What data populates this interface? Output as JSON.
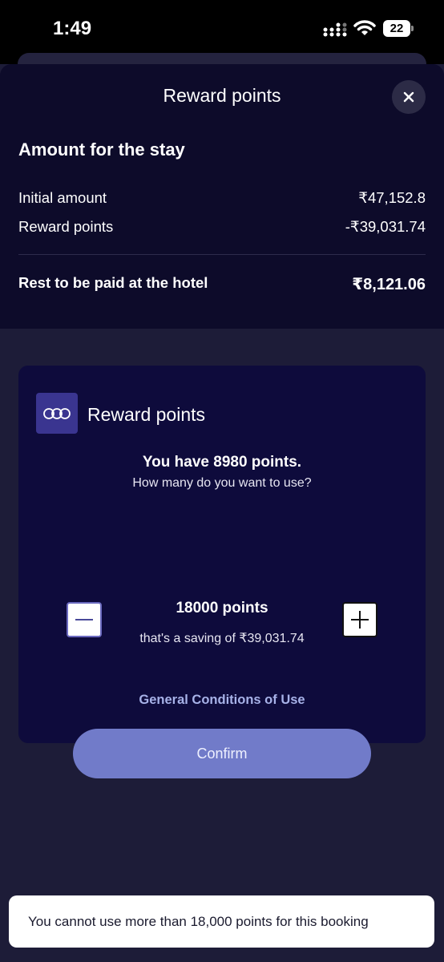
{
  "status_bar": {
    "time": "1:49",
    "battery": "22",
    "icons": [
      "signal-icon",
      "wifi-icon",
      "battery-icon"
    ]
  },
  "sheet": {
    "title": "Reward points",
    "close_icon": "close-icon"
  },
  "summary": {
    "section_title": "Amount for the stay",
    "initial_label": "Initial amount",
    "initial_value": "₹47,152.8",
    "reward_label": "Reward points",
    "reward_value": "-₹39,031.74",
    "rest_label": "Rest to be paid at the hotel",
    "rest_value": "₹8,121.06"
  },
  "reward_card": {
    "logo_icon": "loyalty-logo-icon",
    "title": "Reward points",
    "balance": "You have 8980 points.",
    "question": "How many do you want to use?",
    "points_value": "18000 points",
    "saving": "that's a saving of ₹39,031.74",
    "conditions_link": "General Conditions of Use",
    "confirm_label": "Confirm"
  },
  "toast": {
    "message": "You cannot use more than 18,000 points for this booking"
  },
  "colors": {
    "header_bg": "#0d0b2a",
    "card_bg": "#0e0b3c",
    "confirm_bg": "#717bc9",
    "link": "#a7b2e8"
  }
}
